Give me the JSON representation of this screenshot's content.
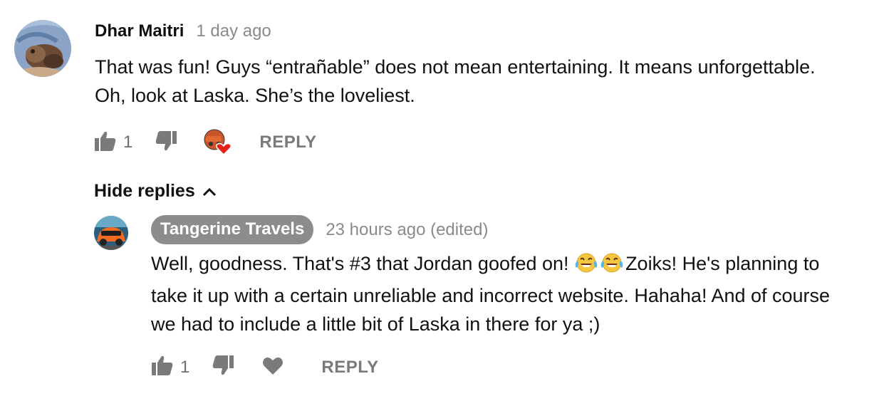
{
  "comment": {
    "author": "Dhar Maitri",
    "time": "1 day ago",
    "text_line1": "That was fun! Guys “entrañable” does not mean entertaining. It means unforgettable.",
    "text_line2": "Oh, look at Laska. She’s the loveliest.",
    "like_count": "1",
    "reply_label": "REPLY",
    "creator_heart": true
  },
  "hide_replies_label": "Hide replies",
  "reply": {
    "author": "Tangerine Travels",
    "time": "23 hours ago (edited)",
    "text_line1_a": "Well, goodness. That's #3 that Jordan goofed on! ",
    "text_line1_b": "Zoiks! He's planning to",
    "text_line2": "take it up with a certain unreliable and incorrect website. Hahaha! And of course",
    "text_line3": "we had to include a little bit of Laska in there for ya ;)",
    "emojis": [
      "face-with-tears-of-joy",
      "face-with-tears-of-joy"
    ],
    "like_count": "1",
    "reply_label": "REPLY"
  },
  "colors": {
    "meta_gray": "#8a8a8a",
    "icon_gray": "#7a7a7a",
    "author_chip_bg": "#8c8c8c",
    "heart_red": "#e62117"
  }
}
